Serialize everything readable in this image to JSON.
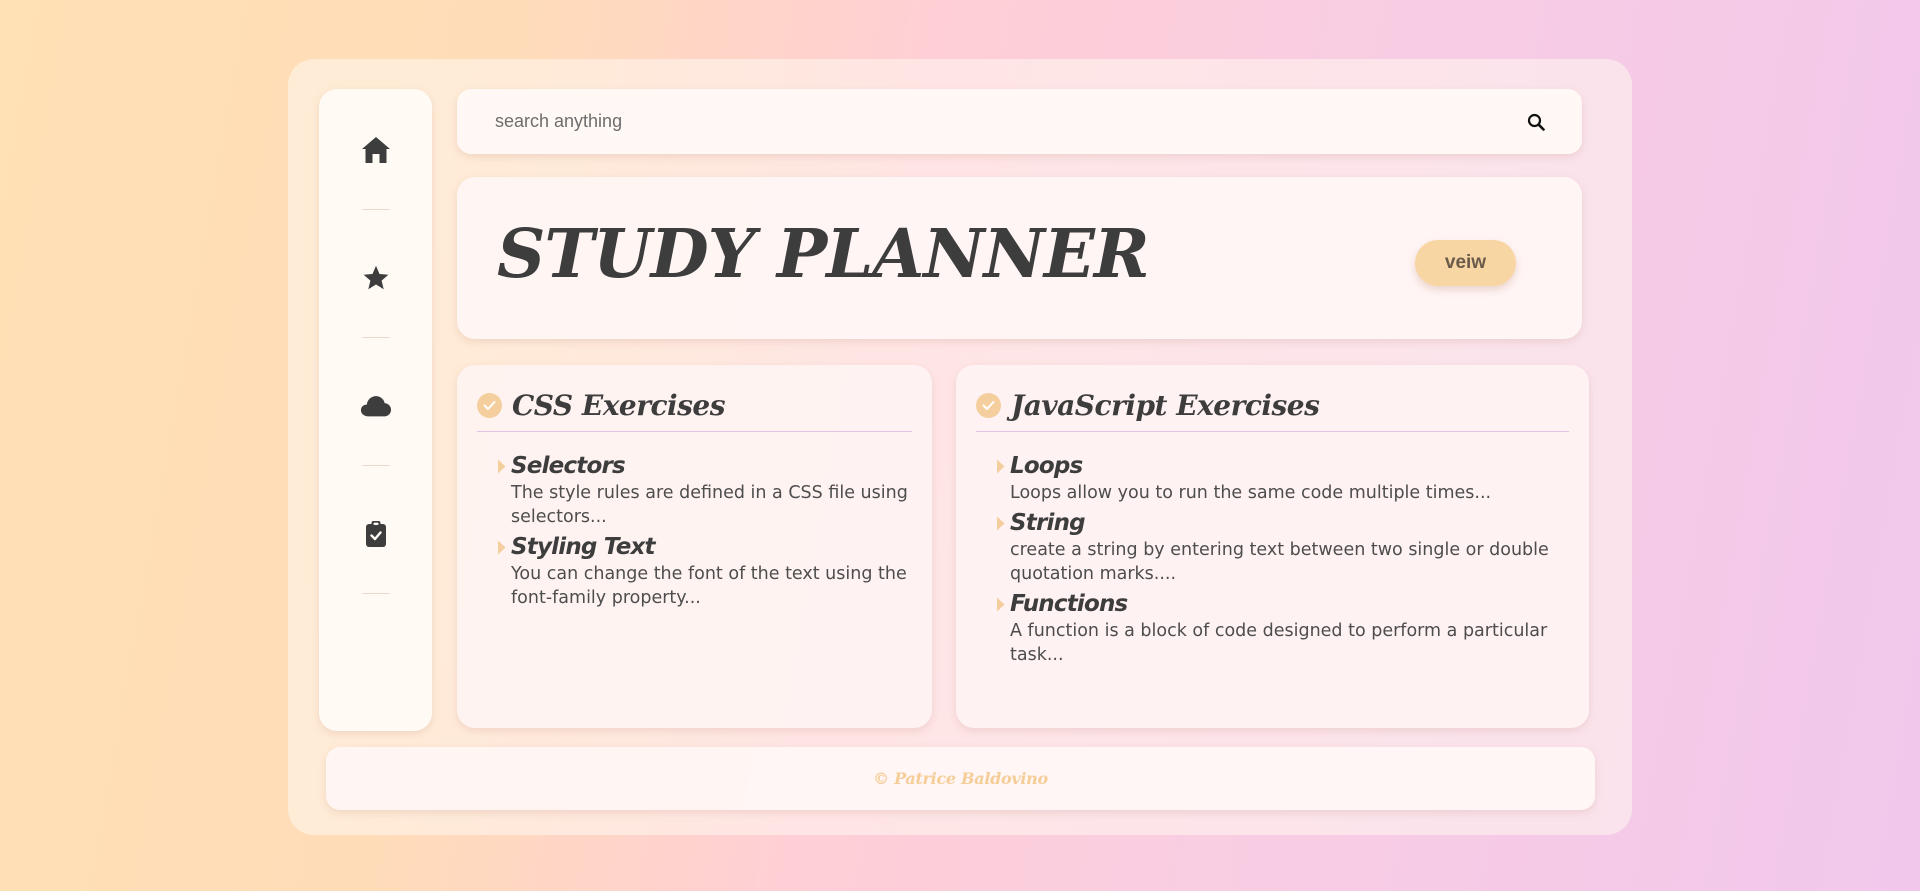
{
  "colors": {
    "accent": "#f8d6a4",
    "check": "#f4cf9d",
    "text": "#3d3d3d",
    "footer_text": "#f5cd97",
    "divider": "#e2c4e4"
  },
  "sidebar": {
    "items": [
      {
        "icon": "home-icon"
      },
      {
        "icon": "star-icon"
      },
      {
        "icon": "cloud-icon"
      },
      {
        "icon": "clipboard-icon"
      }
    ]
  },
  "search": {
    "placeholder": "search anything",
    "icon": "search-icon"
  },
  "hero": {
    "title": "STUDY PLANNER",
    "button_label": "veiw"
  },
  "cards": [
    {
      "title": "CSS Exercises",
      "icon": "check-circle-icon",
      "topics": [
        {
          "title": "Selectors",
          "desc": "The style rules are defined in a CSS file using selectors..."
        },
        {
          "title": "Styling Text",
          "desc": "You can change the font of the text using the font-family property..."
        }
      ]
    },
    {
      "title": "JavaScript Exercises",
      "icon": "check-circle-icon",
      "topics": [
        {
          "title": "Loops",
          "desc": "Loops allow you to run the same code multiple times..."
        },
        {
          "title": "String",
          "desc": "create a string by entering text between two single or double quotation marks...."
        },
        {
          "title": "Functions",
          "desc": "A function is a block of code designed to perform a particular task..."
        }
      ]
    }
  ],
  "footer": {
    "text": "© Patrice Baldovino"
  }
}
